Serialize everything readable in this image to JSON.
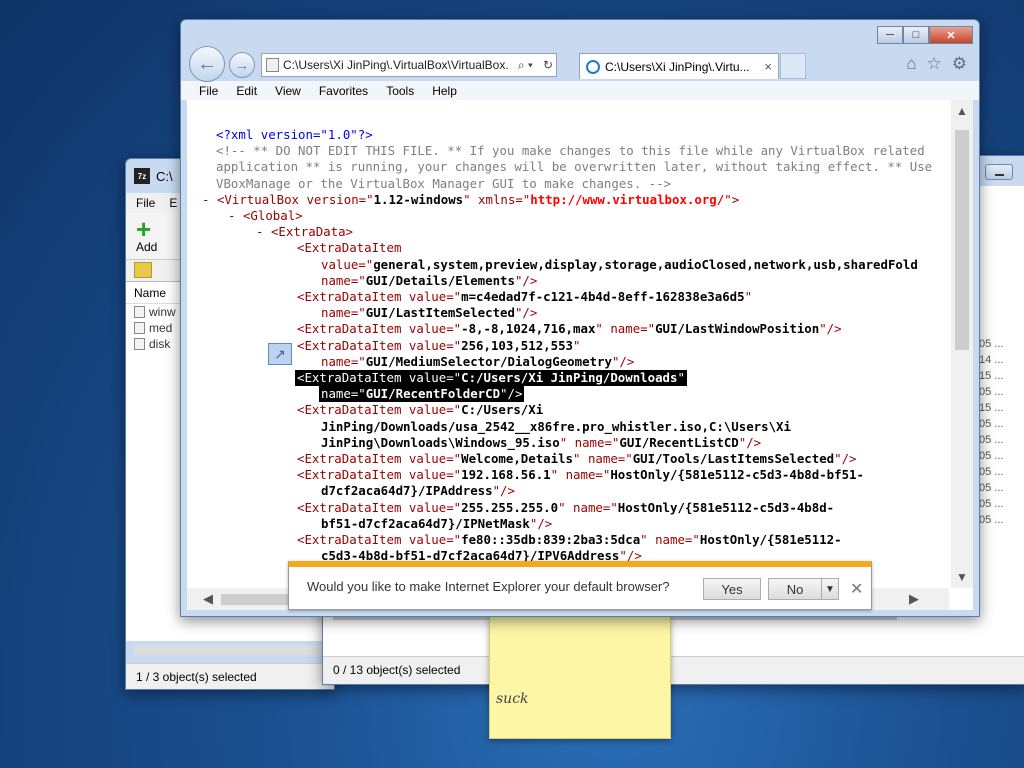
{
  "zip_window": {
    "title": "C:\\",
    "menu": [
      "File",
      "E"
    ],
    "add_label": "Add",
    "col_name": "Name",
    "rows": [
      "winw",
      "med",
      "disk"
    ],
    "status": "1 / 3 object(s) selected"
  },
  "explorer_window": {
    "status": "0 / 13 object(s) selected",
    "date_fragments": [
      "05 ...",
      "14 ...",
      "15 ...",
      "05 ...",
      "15 ...",
      "05 ...",
      "05 ...",
      "05 ...",
      "05 ...",
      "05 ...",
      "05 ...",
      "05 ..."
    ]
  },
  "sticky_note": {
    "text": "suck"
  },
  "ie": {
    "address": "C:\\Users\\Xi JinPing\\.VirtualBox\\VirtualBox.",
    "search_glyph": "⌕ ▾",
    "refresh_glyph": "↻",
    "tab_label": "C:\\Users\\Xi JinPing\\.Virtu...",
    "tab_close": "×",
    "menu": [
      "File",
      "Edit",
      "View",
      "Favorites",
      "Tools",
      "Help"
    ],
    "colors": {
      "tag": "#990000",
      "comment": "#7f7f7f",
      "link": "#ff0000",
      "pi": "#0000ee"
    }
  },
  "xml_lines": {
    "l1": "<?xml version=\"1.0\"?>",
    "l2": "<!-- ** DO NOT EDIT THIS FILE. ** If you make changes to this file while any VirtualBox related",
    "l3": "application ** is running, your changes will be overwritten later, without taking effect. ** Use",
    "l4": "VBoxManage or the VirtualBox Manager GUI to make changes. -->",
    "l5_a": "<VirtualBox version=\"",
    "l5_b": "1.12-windows",
    "l5_c": "\" xmlns=\"",
    "l5_d": "http://www.virtualbox.org/",
    "l5_e": "\">",
    "l6": "<Global>",
    "l7": "<ExtraData>",
    "l8": "<ExtraDataItem",
    "l9_a": "value=\"",
    "l9_b": "general,system,preview,display,storage,audioClosed,network,usb,sharedFold",
    "l10_a": "name=\"",
    "l10_b": "GUI/Details/Elements",
    "l10_c": "\"/>",
    "l11_a": "<ExtraDataItem value=\"",
    "l11_b": "m=c4edad7f-c121-4b4d-8eff-162838e3a6d5",
    "l11_c": "\"",
    "l12_a": "name=\"",
    "l12_b": "GUI/LastItemSelected",
    "l12_c": "\"/>",
    "l13_a": "<ExtraDataItem value=\"",
    "l13_b": "-8,-8,1024,716,max",
    "l13_c": "\" name=\"",
    "l13_d": "GUI/LastWindowPosition",
    "l13_e": "\"/>",
    "l14_a": "<ExtraDataItem value=\"",
    "l14_b": "256,103,512,553",
    "l14_c": "\"",
    "l15_a": "name=\"",
    "l15_b": "GUI/MediumSelector/DialogGeometry",
    "l15_c": "\"/>",
    "l16_a": "<ExtraDataItem value=\"",
    "l16_b": "C:/Users/Xi JinPing/Downloads",
    "l16_c": "\"",
    "l17_a": "name=\"",
    "l17_b": "GUI/RecentFolderCD",
    "l17_c": "\"/>",
    "l18_a": "<ExtraDataItem value=\"",
    "l18_b": "C:/Users/Xi",
    "l19": "JinPing/Downloads/usa_2542__x86fre.pro_whistler.iso,C:\\Users\\Xi",
    "l20_a": "JinPing\\Downloads\\Windows_95.iso",
    "l20_b": "\" name=\"",
    "l20_c": "GUI/RecentListCD",
    "l20_d": "\"/>",
    "l21_a": "<ExtraDataItem value=\"",
    "l21_b": "Welcome,Details",
    "l21_c": "\" name=\"",
    "l21_d": "GUI/Tools/LastItemsSelected",
    "l21_e": "\"/>",
    "l22_a": "<ExtraDataItem value=\"",
    "l22_b": "192.168.56.1",
    "l22_c": "\" name=\"",
    "l22_d": "HostOnly/{581e5112-c5d3-4b8d-bf51-",
    "l23_a": "d7cf2aca64d7}/IPAddress",
    "l23_b": "\"/>",
    "l24_a": "<ExtraDataItem value=\"",
    "l24_b": "255.255.255.0",
    "l24_c": "\" name=\"",
    "l24_d": "HostOnly/{581e5112-c5d3-4b8d-",
    "l25_a": "bf51-d7cf2aca64d7}/IPNetMask",
    "l25_b": "\"/>",
    "l26_a": "<ExtraDataItem value=\"",
    "l26_b": "fe80::35db:839:2ba3:5dca",
    "l26_c": "\" name=\"",
    "l26_d": "HostOnly/{581e5112-",
    "l27_a": "c5d3-4b8d-bf51-d7cf2aca64d7}/IPV6Address",
    "l27_b": "\"/>"
  },
  "prompt": {
    "message": "Would you like to make Internet Explorer your default browser?",
    "yes": "Yes",
    "no": "No",
    "drop_glyph": "▼",
    "close_glyph": "✕"
  }
}
